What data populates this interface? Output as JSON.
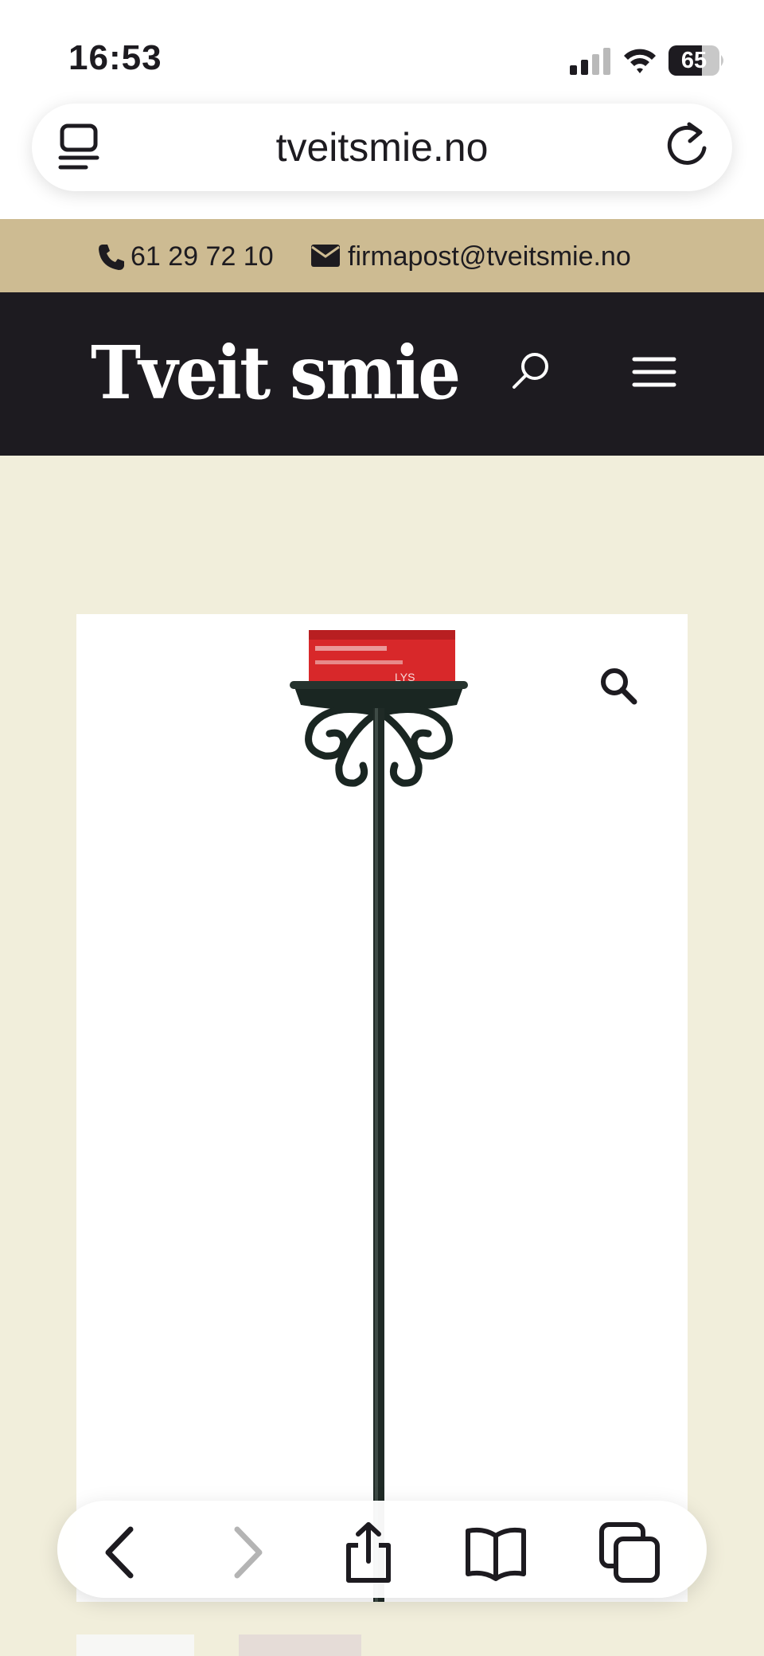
{
  "status_bar": {
    "time": "16:53",
    "battery": "65"
  },
  "browser": {
    "url": "tveitsmie.no"
  },
  "contact": {
    "phone": "61 29 72 10",
    "email": "firmapost@tveitsmie.no"
  },
  "header": {
    "logo_text": "Tveit smie"
  },
  "product": {
    "candle_label": "LYS"
  },
  "colors": {
    "contact_bar": "#cdbb92",
    "header_bg": "#1d1b20",
    "page_bg": "#f1eedb",
    "candle_red": "#d8282a"
  },
  "icons": {
    "tabs": "tabs-overview-icon",
    "reload": "reload-icon",
    "phone": "phone-icon",
    "mail": "mail-icon",
    "search": "search-icon",
    "menu": "hamburger-menu-icon",
    "zoom": "magnifier-icon",
    "toolbar": [
      "back-icon",
      "forward-icon",
      "share-icon",
      "bookmarks-icon",
      "tabs-icon"
    ]
  }
}
